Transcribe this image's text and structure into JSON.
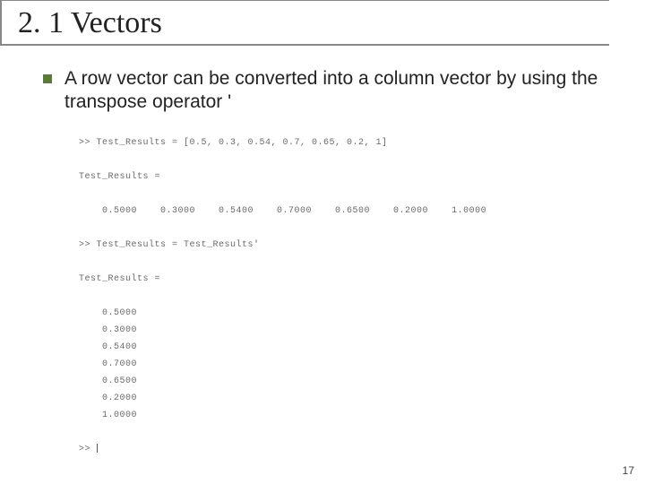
{
  "title": "2. 1 Vectors",
  "bullet": "A row vector can be converted into a column vector by using the transpose operator '",
  "code": {
    "line1": ">> Test_Results = [0.5, 0.3, 0.54, 0.7, 0.65, 0.2, 1]",
    "line2": "Test_Results =",
    "row": "    0.5000    0.3000    0.5400    0.7000    0.6500    0.2000    1.0000",
    "line3": ">> Test_Results = Test_Results'",
    "line4": "Test_Results =",
    "col1": "    0.5000",
    "col2": "    0.3000",
    "col3": "    0.5400",
    "col4": "    0.7000",
    "col5": "    0.6500",
    "col6": "    0.2000",
    "col7": "    1.0000",
    "prompt": ">> "
  },
  "page_num": "17"
}
